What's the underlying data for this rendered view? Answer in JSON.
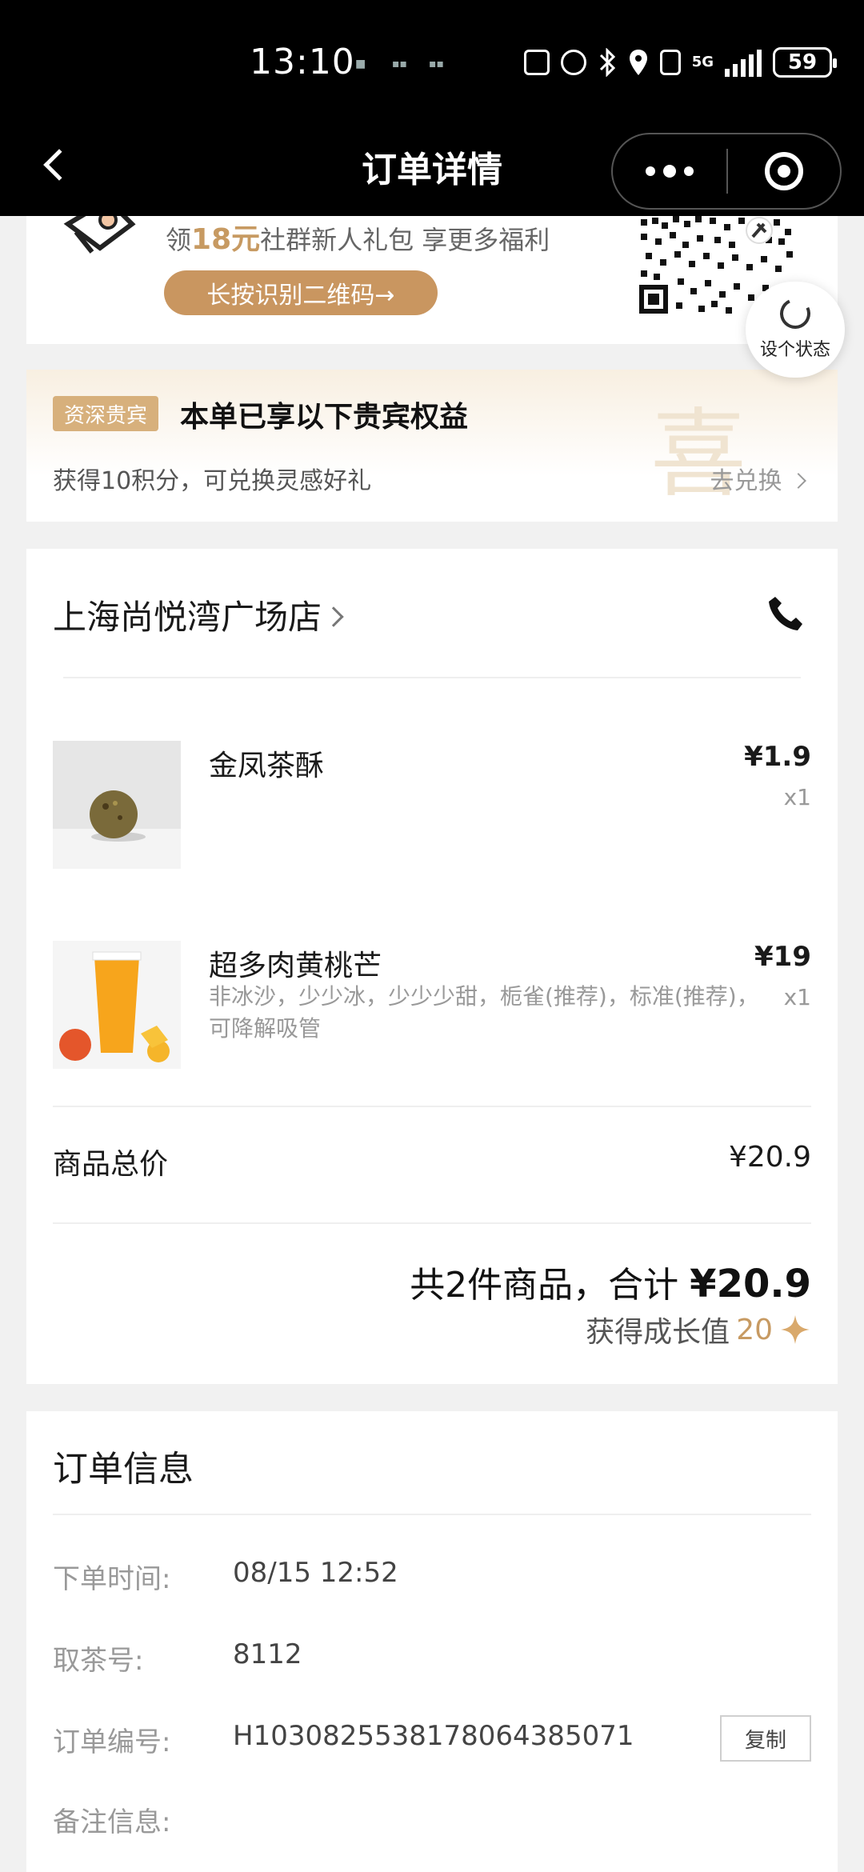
{
  "status_bar": {
    "time": "13:10",
    "net": "5G",
    "battery": "59"
  },
  "nav": {
    "title": "订单详情"
  },
  "banner": {
    "text_prefix": "领",
    "text_amount": "18元",
    "text_suffix": "社群新人礼包 享更多福利",
    "button_label": "长按识别二维码→"
  },
  "status_button": {
    "label": "设个状态"
  },
  "vip": {
    "badge": "资深贵宾",
    "title": "本单已享以下贵宾权益",
    "subtitle": "获得10积分，可兑换灵感好礼",
    "link": "去兑换",
    "watermark": "喜"
  },
  "store": {
    "name": "上海尚悦湾广场店",
    "items": [
      {
        "name": "金凤茶酥",
        "spec": "",
        "price": "¥1.9",
        "qty": "x1"
      },
      {
        "name": "超多肉黄桃芒",
        "spec": "非冰沙，少少冰，少少少甜，栀雀(推荐)，标准(推荐)，可降解吸管",
        "price": "¥19",
        "qty": "x1"
      }
    ],
    "subtotal_label": "商品总价",
    "subtotal_value": "¥20.9",
    "total_prefix": "共2件商品，合计 ",
    "total_value": "¥20.9",
    "growth_label": "获得成长值",
    "growth_value": "20"
  },
  "order_info": {
    "title": "订单信息",
    "rows": [
      {
        "label": "下单时间:",
        "value": "08/15 12:52"
      },
      {
        "label": "取茶号:",
        "value": "8112"
      },
      {
        "label": "订单编号:",
        "value": "H1030825538178064385071"
      },
      {
        "label": "备注信息:",
        "value": ""
      }
    ],
    "copy_label": "复制"
  },
  "colors": {
    "accent_gold": "#c99660",
    "badge_gold": "#d7b07c",
    "background": "#f1f1f1"
  }
}
